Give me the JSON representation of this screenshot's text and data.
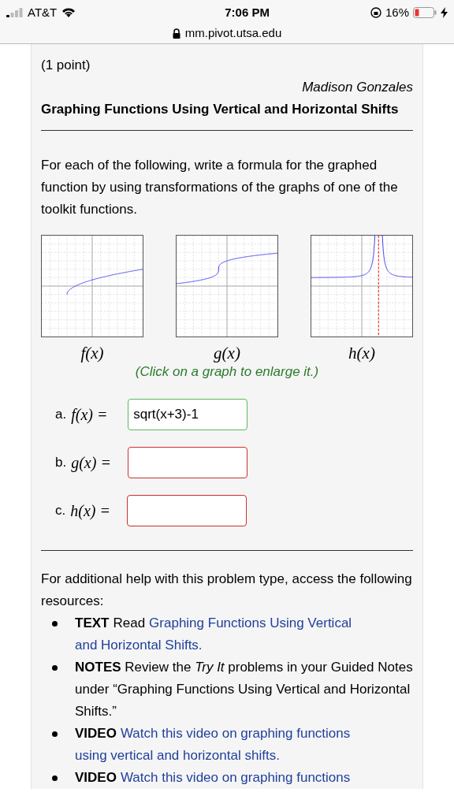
{
  "status_bar": {
    "carrier": "AT&T",
    "time": "7:06 PM",
    "battery": "16%",
    "url": "mm.pivot.utsa.edu"
  },
  "problem": {
    "points": "(1 point)",
    "author": "Madison Gonzales",
    "title": "Graphing Functions Using Vertical and Horizontal Shifts",
    "instructions": "For each of the following, write a formula for the graphed function by using transformations of the graphs of one of the toolkit functions.",
    "graphs": [
      {
        "kind": "sqrt",
        "label": "f(x)"
      },
      {
        "kind": "cbrt",
        "label": "g(x)"
      },
      {
        "kind": "inverse_square",
        "label": "h(x)"
      }
    ],
    "hint": "(Click on a graph to enlarge it.)",
    "answers": [
      {
        "letter": "a.",
        "function": "f(x) =",
        "value": "sqrt(x+3)-1",
        "correct": true
      },
      {
        "letter": "b.",
        "function": "g(x) =",
        "correct": false
      },
      {
        "letter": "c.",
        "function": "h(x) =",
        "correct": false
      }
    ]
  },
  "help": {
    "intro": "For additional help with this problem type, access the following resources:",
    "resources": [
      {
        "label": "TEXT",
        "text": "Read",
        "link_lines": [
          "Graphing Functions Using Vertical",
          "and Horizontal Shifts."
        ]
      },
      {
        "label": "NOTES",
        "text": "Review the *Try It* problems in your Guided Notes under “Graphing Functions Using Vertical and Horizontal Shifts.”"
      },
      {
        "label": "VIDEO",
        "link_lines": [
          "Watch this video on graphing functions",
          "using vertical and horizontal shifts."
        ]
      },
      {
        "label": "VIDEO",
        "link_lines": [
          "Watch this video on graphing functions"
        ]
      }
    ]
  }
}
